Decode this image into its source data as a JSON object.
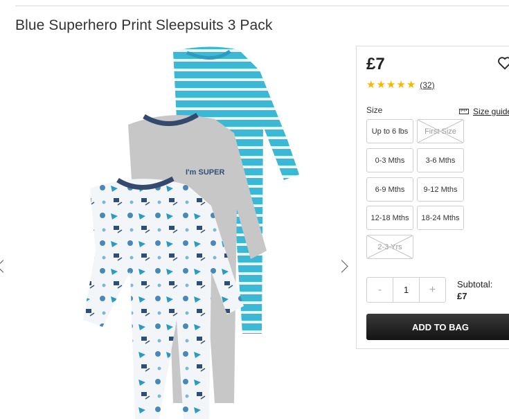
{
  "product": {
    "title": "Blue Superhero Print Sleepsuits 3 Pack",
    "price": "£7",
    "rating_stars": 5,
    "review_count": "(32)"
  },
  "size": {
    "label": "Size",
    "guide_label": "Size guide",
    "options": [
      {
        "label": "Up to 6 lbs",
        "available": true
      },
      {
        "label": "First Size",
        "available": false
      },
      {
        "label": "0-3 Mths",
        "available": true
      },
      {
        "label": "3-6 Mths",
        "available": true
      },
      {
        "label": "6-9 Mths",
        "available": true
      },
      {
        "label": "9-12 Mths",
        "available": true
      },
      {
        "label": "12-18 Mths",
        "available": true
      },
      {
        "label": "18-24 Mths",
        "available": true
      },
      {
        "label": "2-3 Yrs",
        "available": false
      }
    ]
  },
  "quantity": {
    "minus": "-",
    "value": "1",
    "plus": "+"
  },
  "subtotal": {
    "label": "Subtotal:",
    "value": "£7"
  },
  "cart": {
    "add_label": "ADD TO BAG"
  },
  "colors": {
    "star": "#f5b800",
    "stripe_blue": "#3bb8d6",
    "button_dark": "#1e1e1e"
  }
}
